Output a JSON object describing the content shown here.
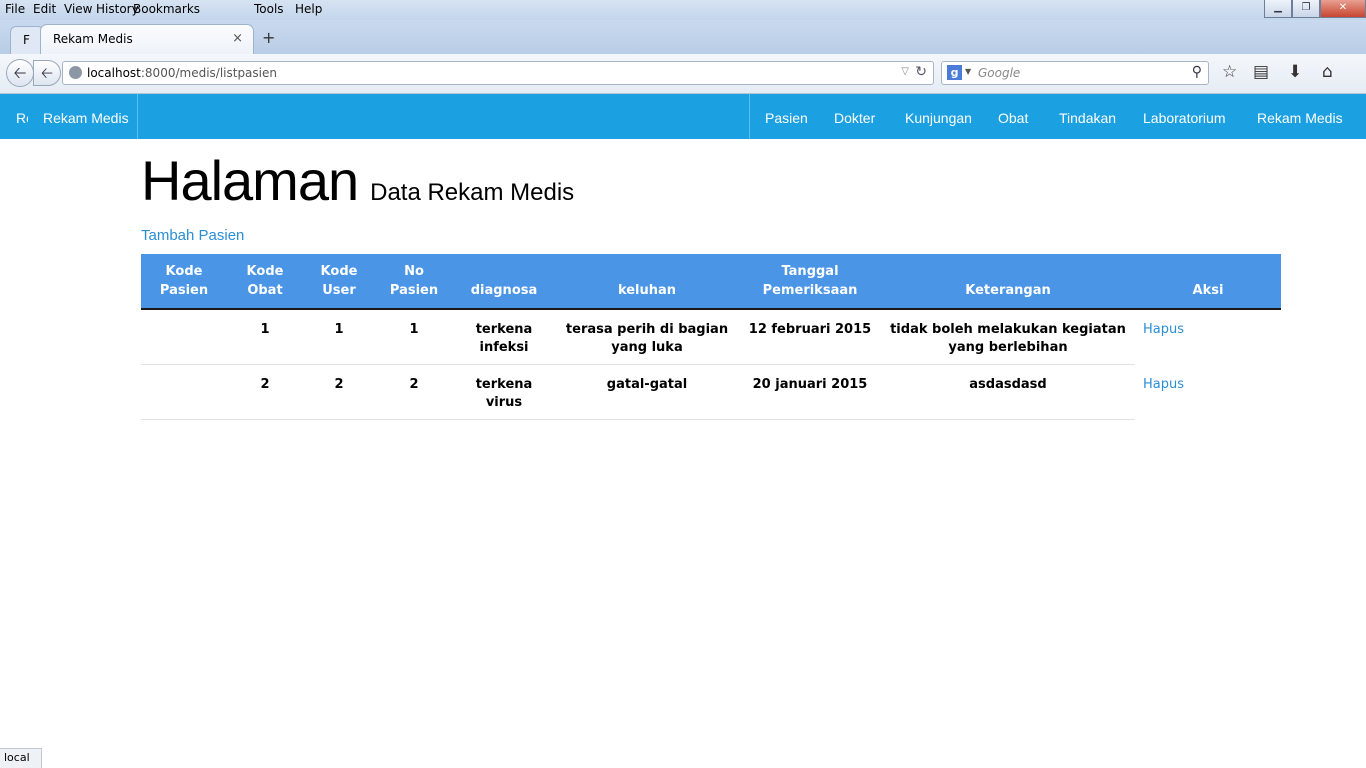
{
  "menu": [
    "File",
    "Edit",
    "View",
    "History",
    "Bookmarks",
    "Tools",
    "Help"
  ],
  "tabs": {
    "prev_label": "F",
    "active_title": "Rekam Medis",
    "close": "×",
    "new": "+"
  },
  "address": {
    "url_host": "localhost",
    "url_path": ":8000/medis/listpasien",
    "search_placeholder": "Google",
    "search_engine": "g"
  },
  "icons": [
    "back-icon",
    "forward-icon",
    "globe-icon",
    "dropdown-icon",
    "reload-icon",
    "google-icon",
    "search-icon",
    "bookmark-star-icon",
    "bookmarks-list-icon",
    "download-icon",
    "home-icon"
  ],
  "appnav": {
    "brand": "Re",
    "brand_link": "Rekam Medis",
    "items": [
      "Pasien",
      "Dokter",
      "Kunjungan",
      "Obat",
      "Tindakan",
      "Laboratorium",
      "Rekam Medis"
    ]
  },
  "page": {
    "title": "Halaman",
    "subtitle": "Data Rekam Medis",
    "add_link": "Tambah Pasien"
  },
  "table": {
    "headers": [
      "Kode Pasien",
      "Kode Obat",
      "Kode User",
      "No Pasien",
      "diagnosa",
      "keluhan",
      "Tanggal Pemeriksaan",
      "Keterangan",
      "Aksi"
    ],
    "rows": [
      [
        "",
        "1",
        "1",
        "1",
        "terkena infeksi",
        "terasa perih di bagian yang luka",
        "12 februari 2015",
        "tidak boleh melakukan kegiatan yang berlebihan",
        "Hapus"
      ],
      [
        "",
        "2",
        "2",
        "2",
        "terkena virus",
        "gatal-gatal",
        "20 januari 2015",
        "asdasdasd",
        "Hapus"
      ]
    ]
  },
  "status": "local",
  "colors": {
    "appbar": "#1ba1e2",
    "table_header": "#4a95e6",
    "link": "#2b8fd6"
  }
}
